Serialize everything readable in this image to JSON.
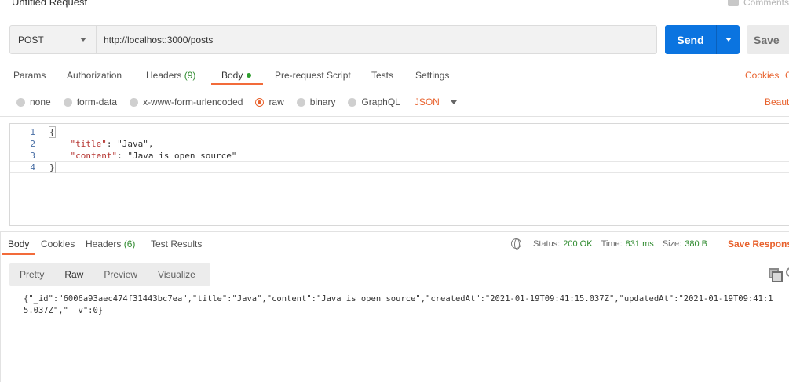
{
  "request": {
    "title": "Untitled Request",
    "comments_label": "Comments",
    "method": "POST",
    "url": "http://localhost:3000/posts",
    "send_label": "Send",
    "save_label": "Save"
  },
  "request_tabs": {
    "params": "Params",
    "authorization": "Authorization",
    "headers": "Headers",
    "headers_count": "(9)",
    "body": "Body",
    "pre_request": "Pre-request Script",
    "tests": "Tests",
    "settings": "Settings",
    "cookies": "Cookies",
    "code_link": "C"
  },
  "body_types": {
    "none": "none",
    "form_data": "form-data",
    "urlencoded": "x-www-form-urlencoded",
    "raw": "raw",
    "binary": "binary",
    "graphql": "GraphQL",
    "format": "JSON",
    "beautify": "Beaut"
  },
  "editor": {
    "lines": [
      {
        "num": "1",
        "text": "{"
      },
      {
        "num": "2",
        "key": "\"title\"",
        "sep": ": ",
        "val": "\"Java\"",
        "tail": ","
      },
      {
        "num": "3",
        "key": "\"content\"",
        "sep": ": ",
        "val": "\"Java is open source\"",
        "tail": ""
      },
      {
        "num": "4",
        "text": "}"
      }
    ]
  },
  "response_tabs": {
    "body": "Body",
    "cookies": "Cookies",
    "headers": "Headers",
    "headers_count": "(6)",
    "test_results": "Test Results"
  },
  "response_status": {
    "status_label": "Status:",
    "status_value": "200 OK",
    "time_label": "Time:",
    "time_value": "831 ms",
    "size_label": "Size:",
    "size_value": "380 B",
    "save_response": "Save Response"
  },
  "response_view": {
    "pretty": "Pretty",
    "raw": "Raw",
    "preview": "Preview",
    "visualize": "Visualize"
  },
  "response_body": "{\"_id\":\"6006a93aec474f31443bc7ea\",\"title\":\"Java\",\"content\":\"Java is open source\",\"createdAt\":\"2021-01-19T09:41:15.037Z\",\"updatedAt\":\"2021-01-19T09:41:15.037Z\",\"__v\":0}",
  "colors": {
    "accent": "#e8612c",
    "send": "#0b74e0",
    "success": "#2e8a2e"
  }
}
